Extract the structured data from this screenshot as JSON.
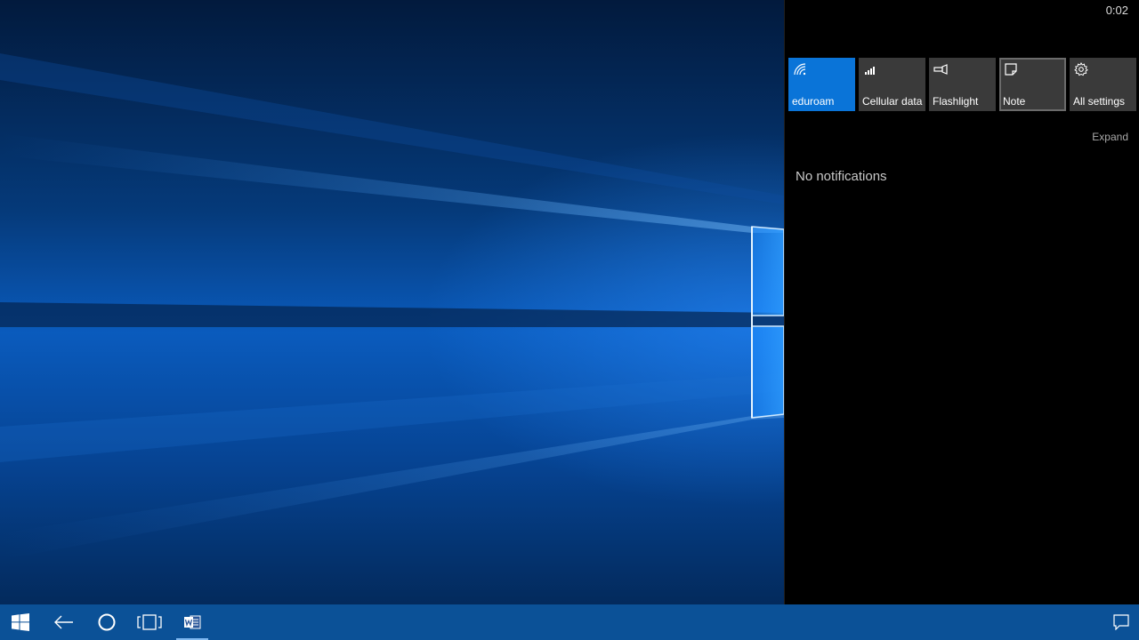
{
  "status": {
    "clock": "0:02"
  },
  "quick_actions": [
    {
      "id": "wifi",
      "label": "eduroam",
      "icon": "wifi-icon",
      "active": true
    },
    {
      "id": "cellular",
      "label": "Cellular data",
      "icon": "cellular-signal-icon",
      "active": false
    },
    {
      "id": "flashlight",
      "label": "Flashlight",
      "icon": "flashlight-icon",
      "active": false
    },
    {
      "id": "note",
      "label": "Note",
      "icon": "note-icon",
      "active": false,
      "focused": true
    },
    {
      "id": "settings",
      "label": "All settings",
      "icon": "gear-icon",
      "active": false
    }
  ],
  "action_center": {
    "expand_label": "Expand",
    "empty_message": "No notifications"
  },
  "taskbar": {
    "buttons": [
      "start-button",
      "back-button",
      "cortana-button",
      "task-view-button",
      "word-app-button"
    ],
    "tray": [
      "action-center-icon"
    ]
  },
  "colors": {
    "accent": "#0a74d8",
    "taskbar": "#0b5197",
    "tile": "#3a3a3a"
  }
}
